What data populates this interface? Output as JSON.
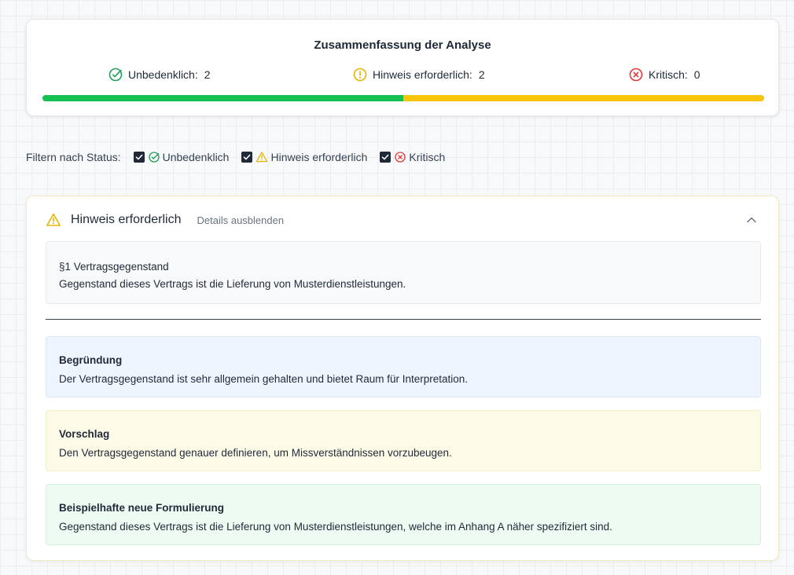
{
  "summary": {
    "title": "Zusammenfassung der Analyse",
    "ok_label": "Unbedenklich:",
    "ok_count": "2",
    "warn_label": "Hinweis erforderlich:",
    "warn_count": "2",
    "crit_label": "Kritisch:",
    "crit_count": "0",
    "progress": {
      "ok_fraction": 0.5,
      "warn_fraction": 0.5,
      "crit_fraction": 0.0
    }
  },
  "filter": {
    "label": "Filtern nach Status:",
    "options": [
      {
        "label": "Unbedenklich",
        "checked": true,
        "icon": "check-circle-icon"
      },
      {
        "label": "Hinweis erforderlich",
        "checked": true,
        "icon": "warning-triangle-icon"
      },
      {
        "label": "Kritisch",
        "checked": true,
        "icon": "x-circle-icon"
      }
    ]
  },
  "detail": {
    "status_title": "Hinweis erforderlich",
    "toggle_label": "Details ausblenden",
    "clause_heading": "§1 Vertragsgegenstand",
    "clause_text": "Gegenstand dieses Vertrags ist die Lieferung von Musterdienstleistungen.",
    "reason_title": "Begründung",
    "reason_text": "Der Vertragsgegenstand ist sehr allgemein gehalten und bietet Raum für Interpretation.",
    "suggestion_title": "Vorschlag",
    "suggestion_text": "Den Vertragsgegenstand genauer definieren, um Missverständnissen vorzubeugen.",
    "example_title": "Beispielhafte neue Formulierung",
    "example_text": "Gegenstand dieses Vertrags ist die Lieferung von Musterdienstleistungen, welche im Anhang A näher spezifiziert sind."
  },
  "colors": {
    "ok": "#16c153",
    "warn": "#f8c40c",
    "crit": "#e53935",
    "ok_icon": "#22a05a",
    "warn_icon": "#e8b400"
  }
}
